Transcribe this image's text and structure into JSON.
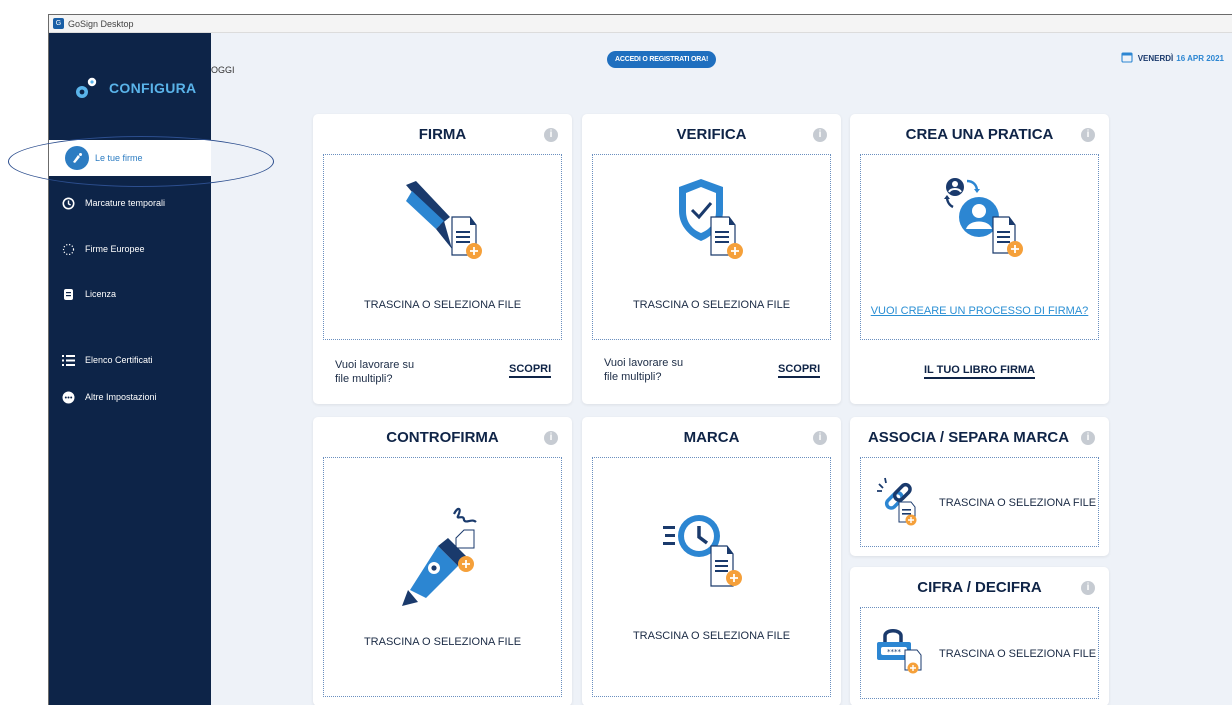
{
  "window": {
    "title": "GoSign Desktop",
    "app_icon": "gosign-app-icon"
  },
  "sidebar": {
    "brand": "CONFIGURA",
    "items": [
      {
        "label": "Le tue firme",
        "icon": "signature-icon",
        "active": true
      },
      {
        "label": "Marcature temporali",
        "icon": "clock-icon"
      },
      {
        "label": "Firme Europee",
        "icon": "eu-stars-icon"
      },
      {
        "label": "Licenza",
        "icon": "license-icon"
      },
      {
        "label": "Elenco Certificati",
        "icon": "list-icon"
      },
      {
        "label": "Altre Impostazioni",
        "icon": "more-icon"
      }
    ]
  },
  "header": {
    "oggi_fragment": "OGGI",
    "cta": "ACCEDI O REGISTRATI ORA!",
    "date_day": "VENERDÌ",
    "date_value": "16 APR 2021"
  },
  "cards": {
    "firma": {
      "title": "FIRMA",
      "drop_text": "TRASCINA O SELEZIONA FILE",
      "foot_line1": "Vuoi lavorare su",
      "foot_line2": "file multipli?",
      "action": "SCOPRI"
    },
    "verifica": {
      "title": "VERIFICA",
      "drop_text": "TRASCINA O SELEZIONA FILE",
      "foot_line1": "Vuoi lavorare su",
      "foot_line2": "file multipli?",
      "action": "SCOPRI"
    },
    "crea": {
      "title": "CREA UNA PRATICA",
      "link": "VUOI CREARE UN PROCESSO DI FIRMA?",
      "action": "IL TUO LIBRO FIRMA"
    },
    "controfirma": {
      "title": "CONTROFIRMA",
      "drop_text": "TRASCINA O SELEZIONA FILE"
    },
    "marca": {
      "title": "MARCA",
      "drop_text": "TRASCINA O SELEZIONA FILE"
    },
    "associa": {
      "title": "ASSOCIA / SEPARA MARCA",
      "drop_text": "TRASCINA O SELEZIONA FILE"
    },
    "cifra": {
      "title": "CIFRA / DECIFRA",
      "drop_text": "TRASCINA O SELEZIONA FILE"
    }
  },
  "info_symbol": "i",
  "colors": {
    "sidebar": "#0d2448",
    "accent": "#2c7cc2",
    "orange": "#f5a03a",
    "title": "#0f2447"
  }
}
